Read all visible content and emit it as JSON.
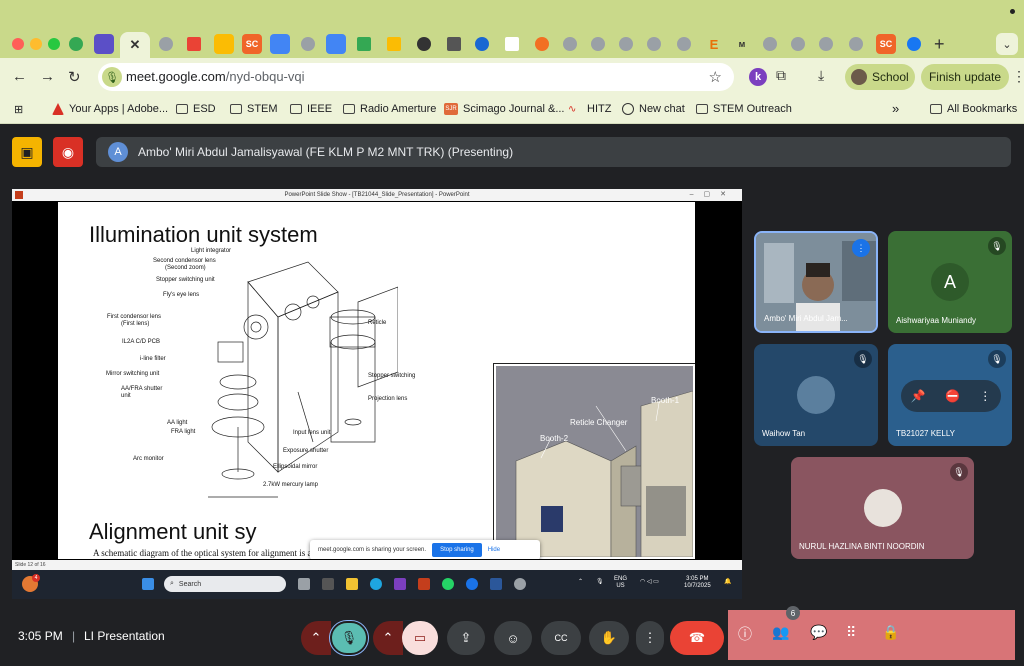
{
  "browser": {
    "url_host": "meet.google.com",
    "url_path": "/nyd-obqu-vqi",
    "profile_label": "School",
    "update_label": "Finish update",
    "new_tab_glyph": "+",
    "bookmarks": [
      {
        "label": "Your Apps | Adobe..."
      },
      {
        "label": "ESD"
      },
      {
        "label": "STEM"
      },
      {
        "label": "IEEE"
      },
      {
        "label": "Radio Amerture"
      },
      {
        "label": "Scimago Journal &..."
      },
      {
        "label": "HITZ"
      },
      {
        "label": "New chat"
      },
      {
        "label": "STEM Outreach"
      }
    ],
    "more_bookmarks_glyph": "»",
    "all_bookmarks_label": "All Bookmarks"
  },
  "meet": {
    "presenter_initial": "A",
    "presenting_text": "Ambo' Miri Abdul Jamalisyawal (FE KLM P M2 MNT TRK) (Presenting)",
    "time": "3:05 PM",
    "separator": "|",
    "meeting_name": "LI Presentation",
    "participant_count": "6"
  },
  "shared_screen": {
    "window_title": "PowerPoint Slide Show - [TB21044_Slide_Presentation] - PowerPoint",
    "slide_title_1": "Illumination unit system",
    "slide_title_2": "Alignment unit sy",
    "slide_subtitle": "A schematic diagram of the optical system for alignment is as shown below:",
    "diagram_labels": [
      "Light integrator",
      "Second condensor lens",
      "(Second zoom)",
      "Stopper switching unit",
      "Fly's eye lens",
      "First condensor lens",
      "(First lens)",
      "IL2A C/D PCB",
      "i-line filter",
      "Mirror switching unit",
      "AA/FRA shutter",
      "unit",
      "AA light",
      "FRA light",
      "Arc monitor",
      "Reticle",
      "Stopper switching",
      "Projection lens",
      "Input lens unit",
      "Exposure shutter",
      "Ellipsoidal mirror",
      "2.7kW mercury lamp"
    ],
    "render_labels": {
      "booth1": "Booth-1",
      "booth2": "Booth-2",
      "reticle_changer": "Reticle Changer"
    },
    "share_notice": "meet.google.com is sharing your screen.",
    "stop_sharing": "Stop sharing",
    "hide": "Hide",
    "slide_status": "Slide 12 of 16",
    "taskbar": {
      "search_placeholder": "Search",
      "lang": "ENG",
      "region": "US",
      "time": "3:05 PM",
      "date": "10/7/2025",
      "notif_badge": "4"
    }
  },
  "participants": [
    {
      "name": "Ambo' Miri Abdul Jam...",
      "state": "speaking"
    },
    {
      "name": "Aishwariyaa Muniandy",
      "initial": "A",
      "state": "muted"
    },
    {
      "name": "Waihow Tan",
      "state": "muted"
    },
    {
      "name": "TB21027 KELLY",
      "state": "muted"
    },
    {
      "name": "NURUL HAZLINA BINTI NOORDIN",
      "state": "muted"
    }
  ],
  "colors": {
    "chrome_green": "#c9d98a",
    "meet_bg": "#202124",
    "end_call": "#ea4335",
    "side_panel": "#d87477"
  }
}
